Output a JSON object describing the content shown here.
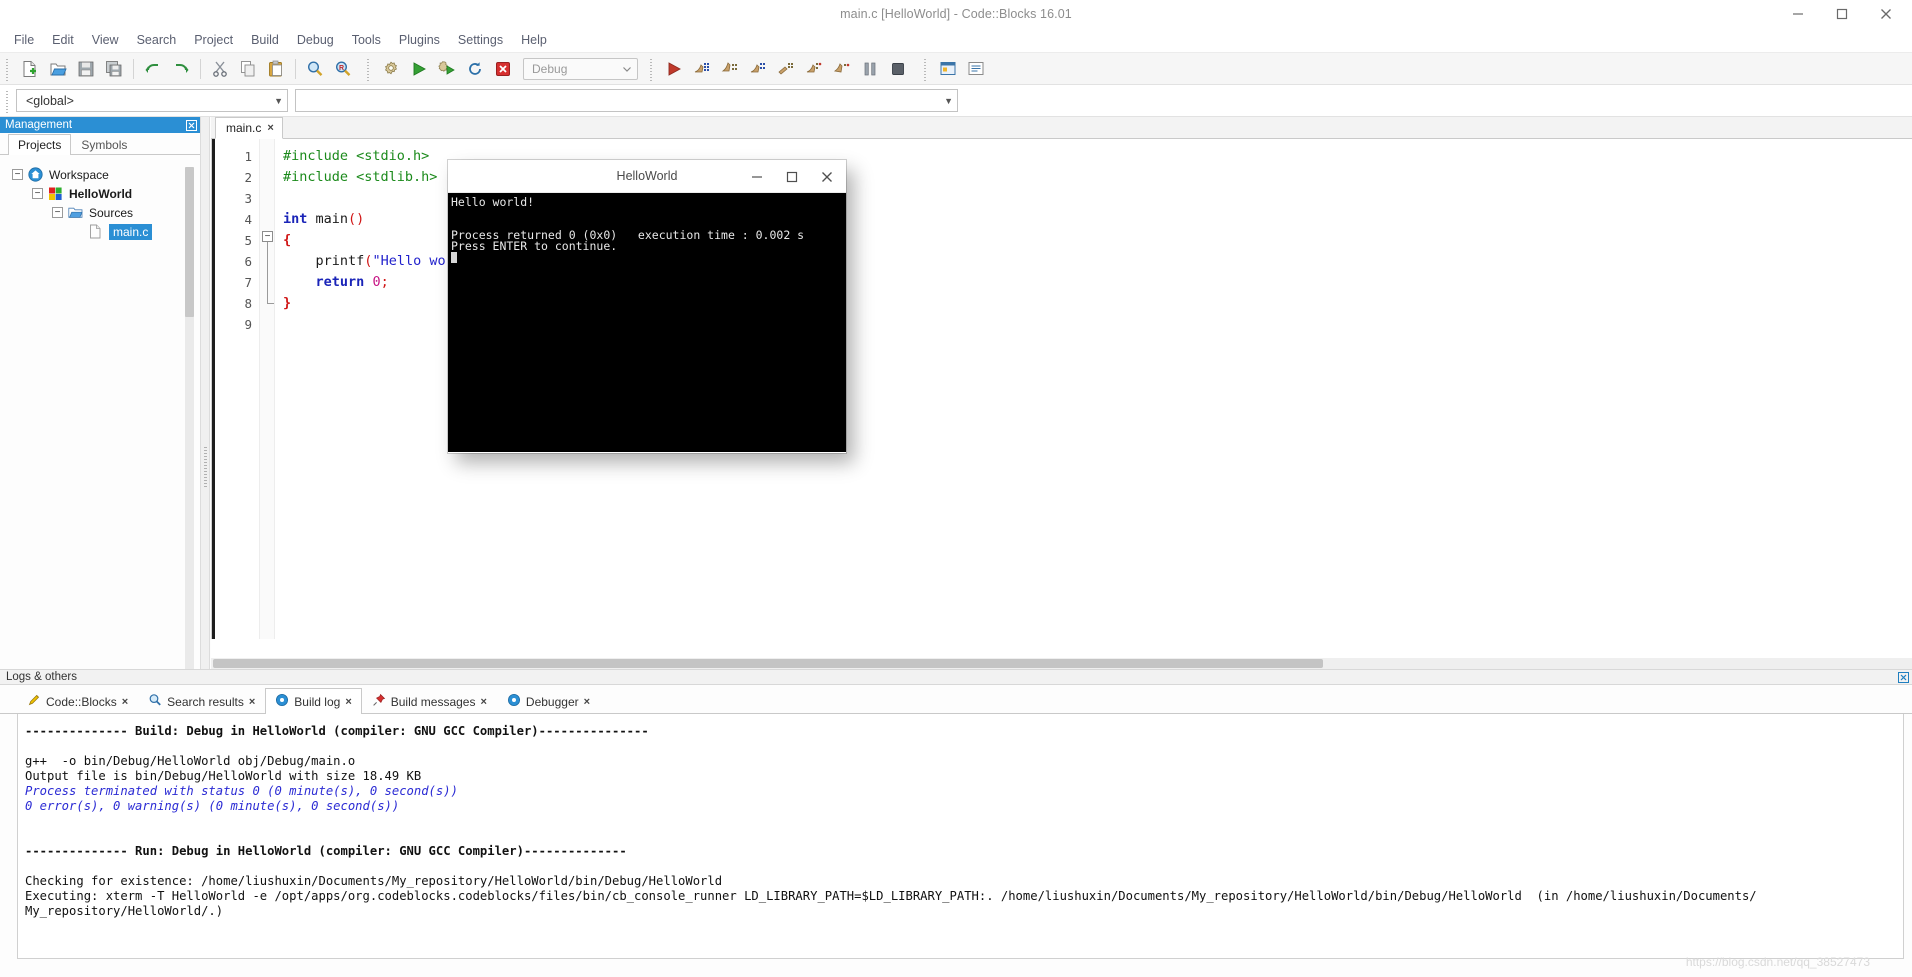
{
  "window": {
    "title": "main.c [HelloWorld] - Code::Blocks 16.01",
    "minimize_label": "Minimize",
    "maximize_label": "Maximize",
    "close_label": "Close"
  },
  "menubar": {
    "items": [
      {
        "label": "File"
      },
      {
        "label": "Edit"
      },
      {
        "label": "View"
      },
      {
        "label": "Search"
      },
      {
        "label": "Project"
      },
      {
        "label": "Build"
      },
      {
        "label": "Debug"
      },
      {
        "label": "Tools"
      },
      {
        "label": "Plugins"
      },
      {
        "label": "Settings"
      },
      {
        "label": "Help"
      }
    ]
  },
  "toolbar": {
    "main_group": [
      {
        "name": "new-file-icon",
        "title": "New file"
      },
      {
        "name": "open-file-icon",
        "title": "Open"
      },
      {
        "name": "save-icon",
        "title": "Save"
      },
      {
        "name": "save-all-icon",
        "title": "Save all"
      }
    ],
    "undo_group": [
      {
        "name": "undo-icon",
        "title": "Undo"
      },
      {
        "name": "redo-icon",
        "title": "Redo"
      }
    ],
    "clipboard_group": [
      {
        "name": "cut-icon",
        "title": "Cut"
      },
      {
        "name": "copy-icon",
        "title": "Copy"
      },
      {
        "name": "paste-icon",
        "title": "Paste"
      }
    ],
    "find_group": [
      {
        "name": "find-icon",
        "title": "Find"
      },
      {
        "name": "replace-icon",
        "title": "Replace"
      }
    ],
    "build_group": [
      {
        "name": "build-gear-icon",
        "title": "Build"
      },
      {
        "name": "run-icon",
        "title": "Run"
      },
      {
        "name": "build-and-run-icon",
        "title": "Build and run"
      },
      {
        "name": "rebuild-icon",
        "title": "Rebuild"
      },
      {
        "name": "abort-icon",
        "title": "Abort"
      }
    ],
    "target_select": {
      "value": "Debug"
    },
    "debug_group": [
      {
        "name": "debug-continue-icon",
        "title": "Debug / Continue"
      },
      {
        "name": "debug-run-to-cursor-icon",
        "title": "Run to cursor"
      },
      {
        "name": "debug-next-line-icon",
        "title": "Next line"
      },
      {
        "name": "debug-step-into-icon",
        "title": "Step into"
      },
      {
        "name": "debug-step-out-icon",
        "title": "Step out"
      },
      {
        "name": "debug-next-instruction-icon",
        "title": "Next instruction"
      },
      {
        "name": "debug-step-into-instruction-icon",
        "title": "Step into instruction"
      },
      {
        "name": "debug-break-icon",
        "title": "Break debugger"
      },
      {
        "name": "debug-stop-icon",
        "title": "Stop debugger"
      }
    ],
    "extra_group": [
      {
        "name": "debugging-windows-icon",
        "title": "Debugging windows"
      },
      {
        "name": "various-info-icon",
        "title": "Various info"
      }
    ]
  },
  "scope_bar": {
    "scope_value": "<global>",
    "function_value": ""
  },
  "management": {
    "title": "Management",
    "close_icon": "close-icon",
    "tabs": [
      {
        "label": "Projects",
        "active": true
      },
      {
        "label": "Symbols",
        "active": false
      }
    ],
    "tree": [
      {
        "label": "Workspace",
        "icon": "workspace-home-icon",
        "expander": "−",
        "depth": 0,
        "selected": false,
        "bold": false
      },
      {
        "label": "HelloWorld",
        "icon": "project-icon",
        "expander": "−",
        "depth": 1,
        "selected": false,
        "bold": true
      },
      {
        "label": "Sources",
        "icon": "folder-open-icon",
        "expander": "−",
        "depth": 2,
        "selected": false,
        "bold": false
      },
      {
        "label": "main.c",
        "icon": "file-icon",
        "expander": "",
        "depth": 3,
        "selected": true,
        "bold": false
      }
    ]
  },
  "editor": {
    "tab": {
      "label": "main.c",
      "close": "×"
    },
    "line_numbers": [
      "1",
      "2",
      "3",
      "4",
      "5",
      "6",
      "7",
      "8",
      "9"
    ],
    "code_lines": [
      "#include <stdio.h>",
      "#include <stdlib.h>",
      "",
      "int main()",
      "{",
      "    printf(\"Hello world!\\n\");",
      "    return 0;",
      "}",
      ""
    ],
    "fold_marker": "−"
  },
  "console": {
    "title": "HelloWorld",
    "minimize_label": "Minimize",
    "maximize_label": "Maximize",
    "close_label": "Close",
    "lines": [
      "Hello world!",
      "",
      "Process returned 0 (0x0)   execution time : 0.002 s",
      "Press ENTER to continue."
    ]
  },
  "logs": {
    "title": "Logs & others",
    "close_icon": "close-icon",
    "tabs": [
      {
        "label": "Code::Blocks",
        "icon": "codeblocks-pencil-icon",
        "close": "×",
        "active": false
      },
      {
        "label": "Search results",
        "icon": "magnifier-icon",
        "close": "×",
        "active": false
      },
      {
        "label": "Build log",
        "icon": "gear-blue-icon",
        "close": "×",
        "active": true
      },
      {
        "label": "Build messages",
        "icon": "pin-icon",
        "close": "×",
        "active": false
      },
      {
        "label": "Debugger",
        "icon": "gear-blue-icon",
        "close": "×",
        "active": false
      }
    ],
    "build_log": [
      {
        "text": "-------------- Build: Debug in HelloWorld (compiler: GNU GCC Compiler)---------------",
        "style": "head"
      },
      {
        "text": "",
        "style": "blank"
      },
      {
        "text": "g++  -o bin/Debug/HelloWorld obj/Debug/main.o",
        "style": "plain"
      },
      {
        "text": "Output file is bin/Debug/HelloWorld with size 18.49 KB",
        "style": "plain"
      },
      {
        "text": "Process terminated with status 0 (0 minute(s), 0 second(s))",
        "style": "blue"
      },
      {
        "text": "0 error(s), 0 warning(s) (0 minute(s), 0 second(s))",
        "style": "blue"
      },
      {
        "text": "",
        "style": "blank"
      },
      {
        "text": "",
        "style": "blank"
      },
      {
        "text": "-------------- Run: Debug in HelloWorld (compiler: GNU GCC Compiler)--------------",
        "style": "head"
      },
      {
        "text": "",
        "style": "blank"
      },
      {
        "text": "Checking for existence: /home/liushuxin/Documents/My_repository/HelloWorld/bin/Debug/HelloWorld",
        "style": "plain"
      },
      {
        "text": "Executing: xterm -T HelloWorld -e /opt/apps/org.codeblocks.codeblocks/files/bin/cb_console_runner LD_LIBRARY_PATH=$LD_LIBRARY_PATH:. /home/liushuxin/Documents/My_repository/HelloWorld/bin/Debug/HelloWorld  (in /home/liushuxin/Documents/",
        "style": "plain"
      },
      {
        "text": "My_repository/HelloWorld/.)",
        "style": "plain"
      }
    ],
    "watermark": "https://blog.csdn.net/qq_38527473"
  },
  "colors": {
    "accent": "#2b8fd4",
    "panel_bg": "#f6f6f6",
    "console_bg": "#000000",
    "string": "#2222cc",
    "keyword": "#1a24b8",
    "preprocessor": "#1b8a1b",
    "paren": "#d01616"
  }
}
